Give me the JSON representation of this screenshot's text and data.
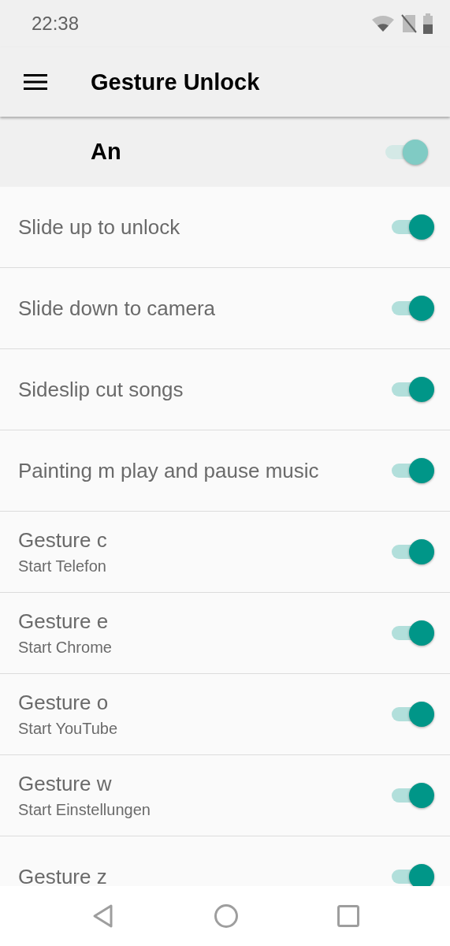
{
  "status_bar": {
    "time": "22:38"
  },
  "app_bar": {
    "title": "Gesture Unlock"
  },
  "master": {
    "label": "An",
    "on": true
  },
  "rows": [
    {
      "title": "Slide up to unlock",
      "on": true
    },
    {
      "title": "Slide down to camera",
      "on": true
    },
    {
      "title": "Sideslip cut songs",
      "on": true
    },
    {
      "title": "Painting m play and pause music",
      "on": true
    },
    {
      "title": "Gesture c",
      "subtitle": "Start Telefon",
      "on": true
    },
    {
      "title": "Gesture e",
      "subtitle": "Start Chrome",
      "on": true
    },
    {
      "title": "Gesture o",
      "subtitle": "Start YouTube",
      "on": true
    },
    {
      "title": "Gesture w",
      "subtitle": "Start Einstellungen",
      "on": true
    },
    {
      "title": "Gesture z",
      "on": true
    }
  ]
}
